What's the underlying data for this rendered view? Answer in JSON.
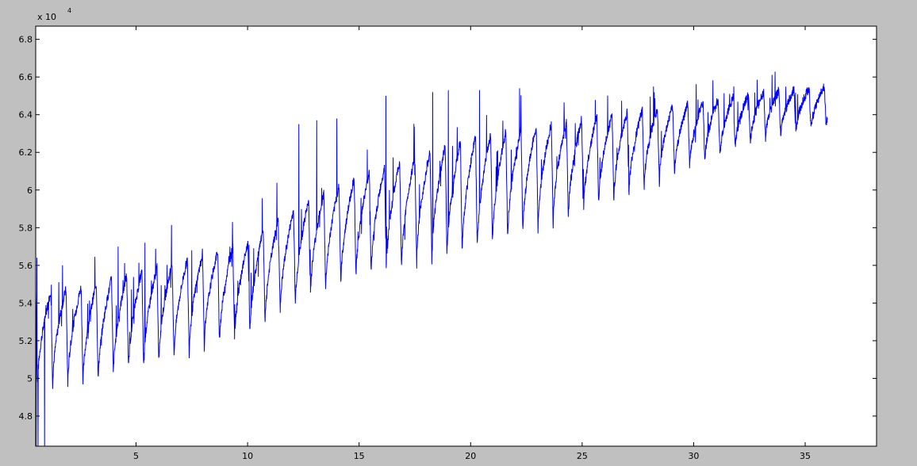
{
  "figure": {
    "background_color": "#c0c0c0",
    "axes_color": "#ffffff",
    "line_color": "#0000ff",
    "exponent_prefix": "x 10",
    "exponent_power": "4"
  },
  "chart_data": {
    "type": "line",
    "title": "",
    "xlabel": "",
    "ylabel": "",
    "grid": false,
    "xlim": [
      0.5,
      38.2
    ],
    "ylim": [
      4.64,
      6.87
    ],
    "y_scale_exponent": 4,
    "x_ticks": [
      5,
      10,
      15,
      20,
      25,
      30,
      35
    ],
    "x_tick_labels": [
      "5",
      "10",
      "15",
      "20",
      "25",
      "30",
      "35"
    ],
    "y_ticks": [
      4.8,
      5.0,
      5.2,
      5.4,
      5.6,
      5.8,
      6.0,
      6.2,
      6.4,
      6.6,
      6.8
    ],
    "y_tick_labels": [
      "4.8",
      "5",
      "5.2",
      "5.4",
      "5.6",
      "5.8",
      "6",
      "6.2",
      "6.4",
      "6.6",
      "6.8"
    ],
    "series": [
      {
        "color": "#0000ff",
        "x_range": [
          0.5,
          36.0
        ],
        "trend_x": [
          0.5,
          3.0,
          5.0,
          10.0,
          11.0,
          13.0,
          15.0,
          20.0,
          25.0,
          30.0,
          33.0,
          36.0
        ],
        "trend_low": [
          4.95,
          4.96,
          5.04,
          5.22,
          5.3,
          5.44,
          5.52,
          5.66,
          5.86,
          6.12,
          6.26,
          6.33
        ],
        "trend_high": [
          5.45,
          5.5,
          5.56,
          5.72,
          5.82,
          5.96,
          6.08,
          6.28,
          6.38,
          6.46,
          6.52,
          6.55
        ],
        "cycle_period": 0.68,
        "spike_peaks": [
          5.64,
          5.6,
          5.7,
          5.72,
          5.68,
          6.35,
          6.37,
          6.38,
          6.5,
          6.52,
          6.53,
          6.53,
          6.54,
          6.55,
          6.55
        ],
        "spike_x": [
          0.55,
          1.7,
          4.2,
          5.4,
          7.5,
          12.3,
          13.1,
          14.0,
          16.2,
          18.3,
          19.0,
          20.4,
          22.2,
          28.2,
          31.8
        ]
      }
    ]
  }
}
